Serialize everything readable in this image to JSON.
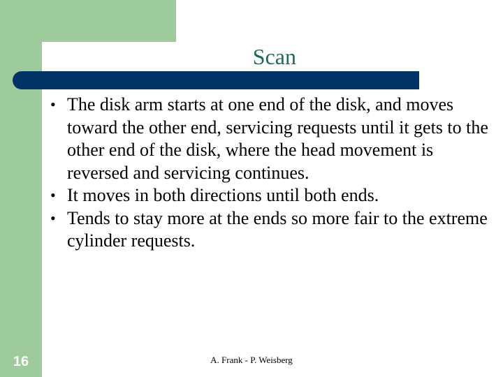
{
  "slide": {
    "title": "Scan",
    "bullets": [
      {
        "marker": "•",
        "text": "The disk arm starts at one end of the disk, and moves toward the other end, servicing requests until it gets to the other end of the disk, where the head movement is reversed and servicing continues."
      },
      {
        "marker": "•",
        "text": "It moves in both directions until both ends."
      },
      {
        "marker": "•",
        "text": "Tends to stay more at the ends so more fair to the extreme cylinder requests."
      }
    ],
    "slide_number": "16",
    "footer": "A. Frank - P. Weisberg"
  },
  "theme": {
    "green": "#9dcb9b",
    "navy": "#003366",
    "title_color": "#1b6a5e"
  }
}
